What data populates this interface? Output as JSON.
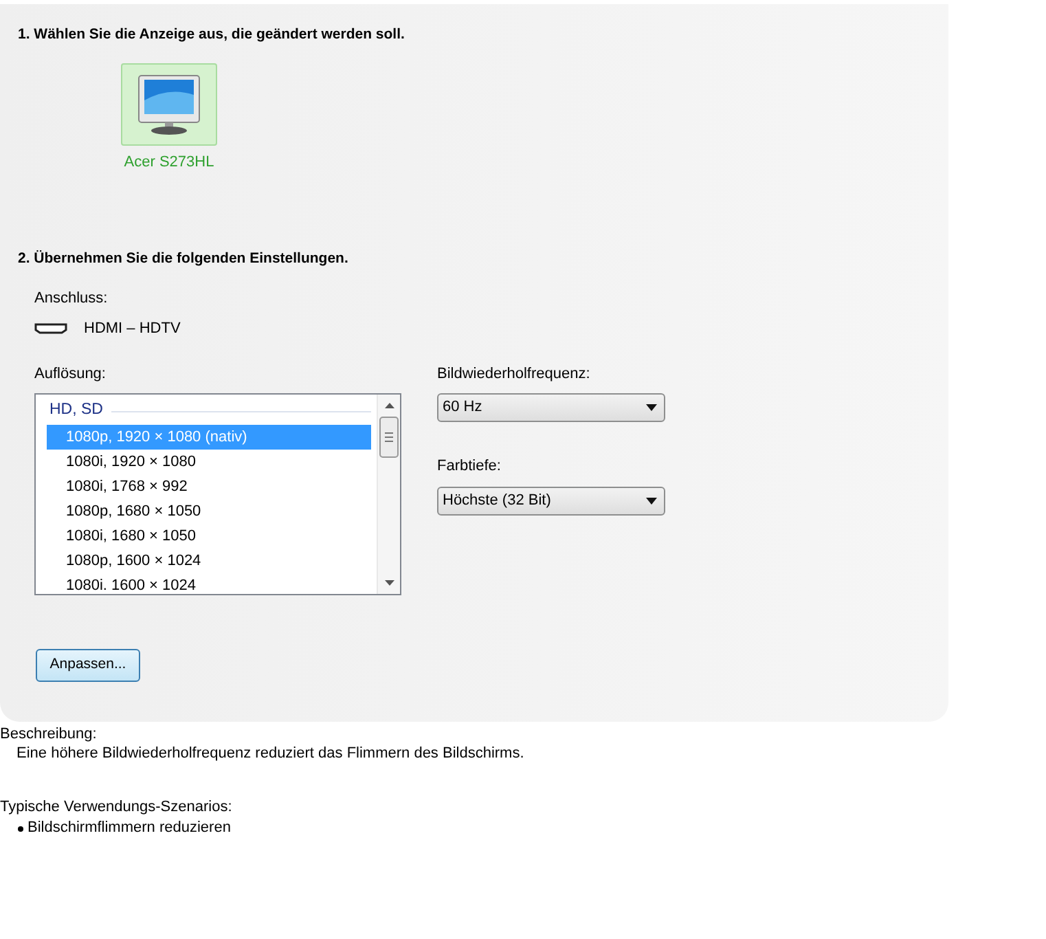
{
  "step1": {
    "heading": "1. Wählen Sie die Anzeige aus, die geändert werden soll.",
    "displays": [
      {
        "label": "Acer S273HL",
        "selected": true
      }
    ]
  },
  "step2": {
    "heading": "2. Übernehmen Sie die folgenden Einstellungen.",
    "connection_label": "Anschluss:",
    "connection": "HDMI – HDTV",
    "resolution_label": "Auflösung:",
    "resolution_list": {
      "group": "HD, SD",
      "items": [
        {
          "text": "1080p, 1920 × 1080 (nativ)",
          "selected": true
        },
        {
          "text": "1080i, 1920 × 1080",
          "selected": false
        },
        {
          "text": "1080i, 1768 × 992",
          "selected": false
        },
        {
          "text": "1080p, 1680 × 1050",
          "selected": false
        },
        {
          "text": "1080i, 1680 × 1050",
          "selected": false
        },
        {
          "text": "1080p, 1600 × 1024",
          "selected": false
        },
        {
          "text": "1080i. 1600 × 1024",
          "selected": false
        }
      ]
    },
    "refresh_label": "Bildwiederholfrequenz:",
    "refresh_value": "60 Hz",
    "depth_label": "Farbtiefe:",
    "depth_value": "Höchste (32 Bit)",
    "customize_button": "Anpassen..."
  },
  "description": {
    "label": "Beschreibung:",
    "text": "Eine höhere Bildwiederholfrequenz reduziert das Flimmern des Bildschirms."
  },
  "scenarios": {
    "label": "Typische Verwendungs-Szenarios:",
    "items": [
      "Bildschirmflimmern reduzieren"
    ]
  }
}
